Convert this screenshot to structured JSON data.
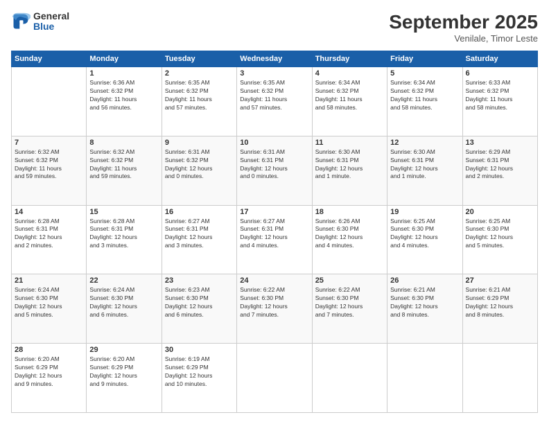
{
  "logo": {
    "general": "General",
    "blue": "Blue"
  },
  "header": {
    "month": "September 2025",
    "location": "Venilale, Timor Leste"
  },
  "weekdays": [
    "Sunday",
    "Monday",
    "Tuesday",
    "Wednesday",
    "Thursday",
    "Friday",
    "Saturday"
  ],
  "weeks": [
    [
      {
        "day": "",
        "info": ""
      },
      {
        "day": "1",
        "info": "Sunrise: 6:36 AM\nSunset: 6:32 PM\nDaylight: 11 hours\nand 56 minutes."
      },
      {
        "day": "2",
        "info": "Sunrise: 6:35 AM\nSunset: 6:32 PM\nDaylight: 11 hours\nand 57 minutes."
      },
      {
        "day": "3",
        "info": "Sunrise: 6:35 AM\nSunset: 6:32 PM\nDaylight: 11 hours\nand 57 minutes."
      },
      {
        "day": "4",
        "info": "Sunrise: 6:34 AM\nSunset: 6:32 PM\nDaylight: 11 hours\nand 58 minutes."
      },
      {
        "day": "5",
        "info": "Sunrise: 6:34 AM\nSunset: 6:32 PM\nDaylight: 11 hours\nand 58 minutes."
      },
      {
        "day": "6",
        "info": "Sunrise: 6:33 AM\nSunset: 6:32 PM\nDaylight: 11 hours\nand 58 minutes."
      }
    ],
    [
      {
        "day": "7",
        "info": "Sunrise: 6:32 AM\nSunset: 6:32 PM\nDaylight: 11 hours\nand 59 minutes."
      },
      {
        "day": "8",
        "info": "Sunrise: 6:32 AM\nSunset: 6:32 PM\nDaylight: 11 hours\nand 59 minutes."
      },
      {
        "day": "9",
        "info": "Sunrise: 6:31 AM\nSunset: 6:32 PM\nDaylight: 12 hours\nand 0 minutes."
      },
      {
        "day": "10",
        "info": "Sunrise: 6:31 AM\nSunset: 6:31 PM\nDaylight: 12 hours\nand 0 minutes."
      },
      {
        "day": "11",
        "info": "Sunrise: 6:30 AM\nSunset: 6:31 PM\nDaylight: 12 hours\nand 1 minute."
      },
      {
        "day": "12",
        "info": "Sunrise: 6:30 AM\nSunset: 6:31 PM\nDaylight: 12 hours\nand 1 minute."
      },
      {
        "day": "13",
        "info": "Sunrise: 6:29 AM\nSunset: 6:31 PM\nDaylight: 12 hours\nand 2 minutes."
      }
    ],
    [
      {
        "day": "14",
        "info": "Sunrise: 6:28 AM\nSunset: 6:31 PM\nDaylight: 12 hours\nand 2 minutes."
      },
      {
        "day": "15",
        "info": "Sunrise: 6:28 AM\nSunset: 6:31 PM\nDaylight: 12 hours\nand 3 minutes."
      },
      {
        "day": "16",
        "info": "Sunrise: 6:27 AM\nSunset: 6:31 PM\nDaylight: 12 hours\nand 3 minutes."
      },
      {
        "day": "17",
        "info": "Sunrise: 6:27 AM\nSunset: 6:31 PM\nDaylight: 12 hours\nand 4 minutes."
      },
      {
        "day": "18",
        "info": "Sunrise: 6:26 AM\nSunset: 6:30 PM\nDaylight: 12 hours\nand 4 minutes."
      },
      {
        "day": "19",
        "info": "Sunrise: 6:25 AM\nSunset: 6:30 PM\nDaylight: 12 hours\nand 4 minutes."
      },
      {
        "day": "20",
        "info": "Sunrise: 6:25 AM\nSunset: 6:30 PM\nDaylight: 12 hours\nand 5 minutes."
      }
    ],
    [
      {
        "day": "21",
        "info": "Sunrise: 6:24 AM\nSunset: 6:30 PM\nDaylight: 12 hours\nand 5 minutes."
      },
      {
        "day": "22",
        "info": "Sunrise: 6:24 AM\nSunset: 6:30 PM\nDaylight: 12 hours\nand 6 minutes."
      },
      {
        "day": "23",
        "info": "Sunrise: 6:23 AM\nSunset: 6:30 PM\nDaylight: 12 hours\nand 6 minutes."
      },
      {
        "day": "24",
        "info": "Sunrise: 6:22 AM\nSunset: 6:30 PM\nDaylight: 12 hours\nand 7 minutes."
      },
      {
        "day": "25",
        "info": "Sunrise: 6:22 AM\nSunset: 6:30 PM\nDaylight: 12 hours\nand 7 minutes."
      },
      {
        "day": "26",
        "info": "Sunrise: 6:21 AM\nSunset: 6:30 PM\nDaylight: 12 hours\nand 8 minutes."
      },
      {
        "day": "27",
        "info": "Sunrise: 6:21 AM\nSunset: 6:29 PM\nDaylight: 12 hours\nand 8 minutes."
      }
    ],
    [
      {
        "day": "28",
        "info": "Sunrise: 6:20 AM\nSunset: 6:29 PM\nDaylight: 12 hours\nand 9 minutes."
      },
      {
        "day": "29",
        "info": "Sunrise: 6:20 AM\nSunset: 6:29 PM\nDaylight: 12 hours\nand 9 minutes."
      },
      {
        "day": "30",
        "info": "Sunrise: 6:19 AM\nSunset: 6:29 PM\nDaylight: 12 hours\nand 10 minutes."
      },
      {
        "day": "",
        "info": ""
      },
      {
        "day": "",
        "info": ""
      },
      {
        "day": "",
        "info": ""
      },
      {
        "day": "",
        "info": ""
      }
    ]
  ]
}
